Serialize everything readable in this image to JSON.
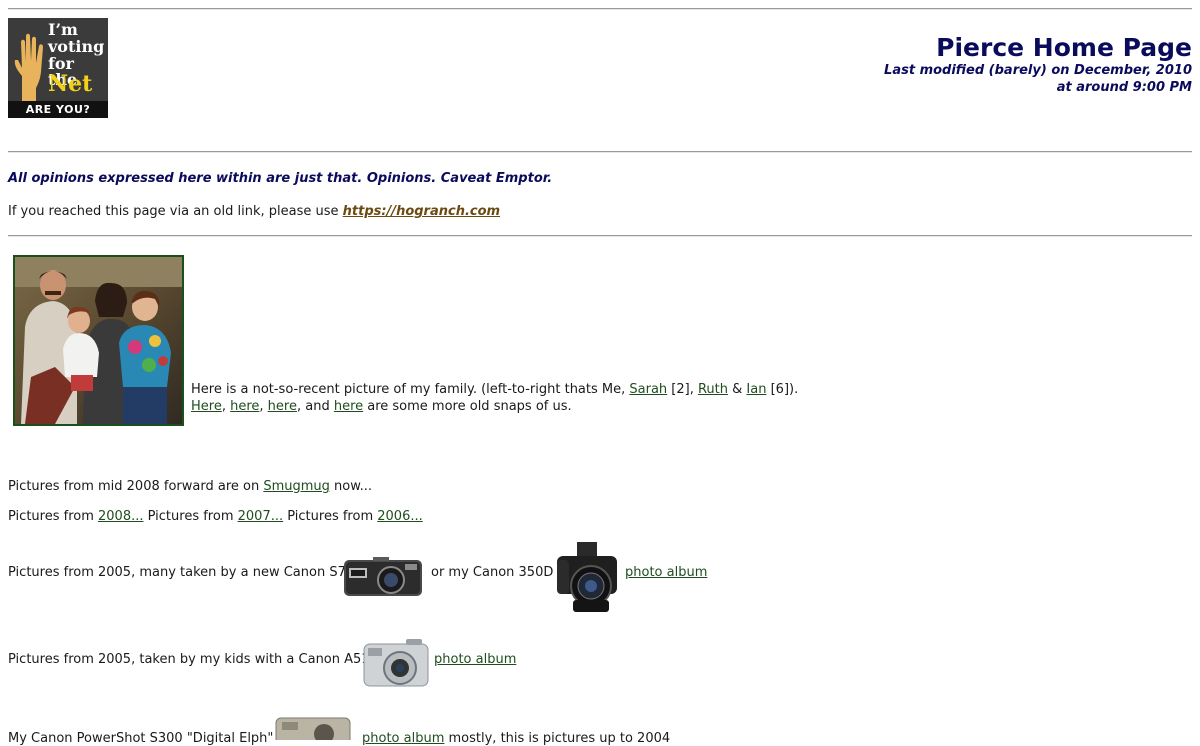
{
  "badge": {
    "line1": "I’m",
    "line2": "voting",
    "line3": "for the",
    "line4": "Net",
    "footer": "ARE YOU?"
  },
  "header": {
    "title": "Pierce Home Page",
    "modified_line1": "Last modified (barely) on December, 2010",
    "modified_line2": "at around 9:00 PM"
  },
  "notice": {
    "opinions": "All opinions expressed here within are just that. Opinions. Caveat Emptor.",
    "old_link_prefix": "If you reached this page via an old link, please use ",
    "old_link_url": "https://hogranch.com"
  },
  "family": {
    "text_prefix": "Here is a not-so-recent picture of my family. (left-to-right thats Me, ",
    "sarah": "Sarah",
    "sarah_age": " [2], ",
    "ruth": "Ruth",
    "amp": " & ",
    "ian": "Ian",
    "ian_age": " [6]).",
    "snaps": [
      "Here",
      "here",
      "here",
      "here"
    ],
    "snaps_sep1": ", ",
    "snaps_sep2": ", ",
    "snaps_and": ", and ",
    "snaps_suffix": " are some more old snaps of us."
  },
  "pictures": {
    "smugmug_prefix": "Pictures from mid 2008 forward are on ",
    "smugmug_link": "Smugmug",
    "smugmug_suffix": " now...",
    "years_prefix1": "Pictures from ",
    "y2008": "2008...",
    "years_prefix2": " Pictures from ",
    "y2007": "2007...",
    "years_prefix3": " Pictures from ",
    "y2006": "2006...",
    "s70_text": "Pictures from 2005, many taken by a new Canon S70",
    "or_350d": "or my Canon 350D",
    "album1": "photo album",
    "a510_text": "Pictures from 2005, taken by my kids with a Canon A510",
    "album2": "photo album",
    "s300_text": "My Canon PowerShot S300 \"Digital Elph\"",
    "album3": "photo album",
    "s300_suffix": " mostly, this is pictures up to 2004"
  }
}
